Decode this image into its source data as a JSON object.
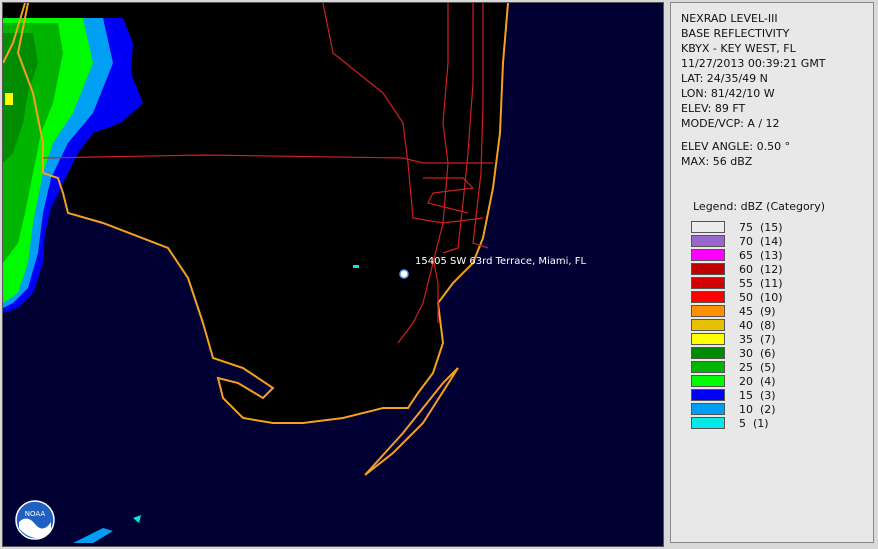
{
  "info": {
    "product": "NEXRAD LEVEL-III",
    "type": "BASE REFLECTIVITY",
    "station": "KBYX - KEY WEST, FL",
    "datetime": "11/27/2013 00:39:21 GMT",
    "lat": "LAT: 24/35/49 N",
    "lon": "LON: 81/42/10 W",
    "elev": "ELEV: 89 FT",
    "mode": "MODE/VCP: A / 12",
    "elev_angle": "ELEV ANGLE: 0.50 °",
    "max": "MAX: 56 dBZ"
  },
  "legend": {
    "title": "Legend: dBZ (Category)",
    "items": [
      {
        "label": "75  (15)",
        "color": "#ececec"
      },
      {
        "label": "70  (14)",
        "color": "#9966cc"
      },
      {
        "label": "65  (13)",
        "color": "#ff00ff"
      },
      {
        "label": "60  (12)",
        "color": "#c00000"
      },
      {
        "label": "55  (11)",
        "color": "#d40000"
      },
      {
        "label": "50  (10)",
        "color": "#ff0000"
      },
      {
        "label": "45  (9)",
        "color": "#ff9000"
      },
      {
        "label": "40  (8)",
        "color": "#e7c000"
      },
      {
        "label": "35  (7)",
        "color": "#ffff00"
      },
      {
        "label": "30  (6)",
        "color": "#008c00"
      },
      {
        "label": "25  (5)",
        "color": "#00b400"
      },
      {
        "label": "20  (4)",
        "color": "#00fb00"
      },
      {
        "label": "15  (3)",
        "color": "#0000f6"
      },
      {
        "label": "10  (2)",
        "color": "#019ff4"
      },
      {
        "label": "5  (1)",
        "color": "#04e9e7"
      }
    ]
  },
  "map": {
    "location_label": "15405 SW 63rd Terrace, Miami, FL",
    "background_color": "#000033",
    "land_color": "#000000",
    "coast_color": "#f4a020",
    "road_color": "#cc2020"
  },
  "logo": {
    "text": "NOAA"
  }
}
